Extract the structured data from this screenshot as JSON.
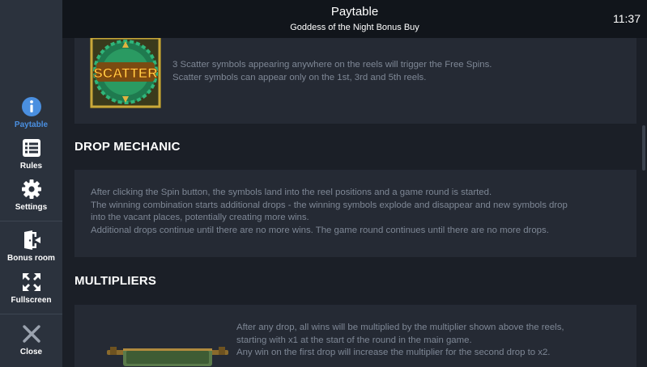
{
  "header": {
    "title": "Paytable",
    "subtitle": "Goddess of the Night Bonus Buy",
    "clock": "11:37"
  },
  "sidebar": {
    "items": [
      {
        "label": "Paytable",
        "icon": "info-icon",
        "active": true
      },
      {
        "label": "Rules",
        "icon": "list-icon",
        "active": false
      },
      {
        "label": "Settings",
        "icon": "gear-icon",
        "active": false
      },
      {
        "label": "Bonus room",
        "icon": "door-exit-icon",
        "active": false
      },
      {
        "label": "Fullscreen",
        "icon": "expand-icon",
        "active": false
      },
      {
        "label": "Close",
        "icon": "close-icon",
        "active": false
      }
    ]
  },
  "scatter": {
    "symbol_text": "SCATTER",
    "lines": [
      "3 Scatter symbols appearing anywhere on the reels will trigger the Free Spins.",
      "Scatter symbols can appear only on the 1st, 3rd and 5th reels."
    ]
  },
  "drop_mechanic": {
    "heading": "DROP MECHANIC",
    "lines": [
      "After clicking the Spin button, the symbols land into the reel positions and a game round is started.",
      "The winning combination starts additional drops - the winning symbols explode and disappear and new symbols drop",
      "into the vacant places, potentially creating more wins.",
      "Additional drops continue until there are no more wins. The game round continues until there are no more drops."
    ]
  },
  "multipliers": {
    "heading": "MULTIPLIERS",
    "lines": [
      "After any drop, all wins will be multiplied by the multiplier shown above the reels,",
      "starting with x1 at the start of the round in the main game.",
      "Any win on the first drop will increase the multiplier for the second drop to x2."
    ]
  },
  "colors": {
    "accent": "#4a8fe0",
    "sidebar_bg": "#2b323d",
    "header_bg": "#11151b",
    "content_bg": "#1b1f27",
    "card_bg": "#252a34",
    "body_text": "#7e8795"
  }
}
